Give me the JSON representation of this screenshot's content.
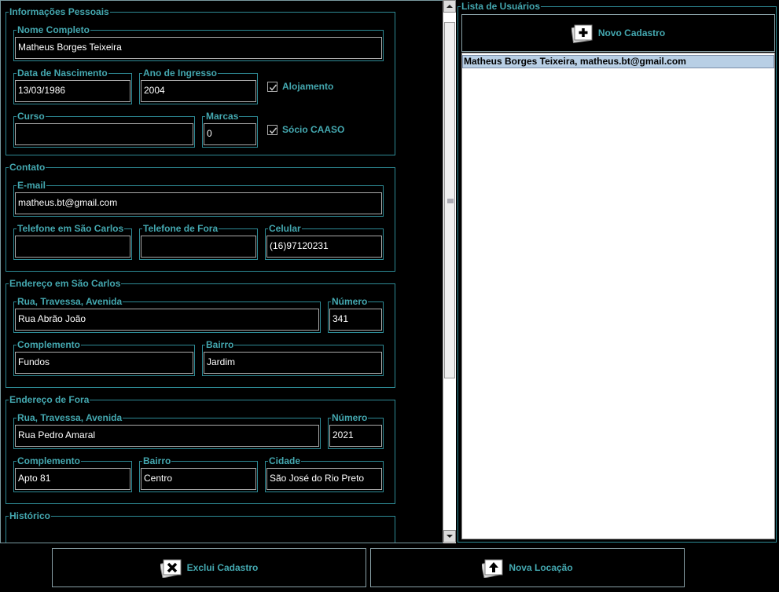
{
  "left_form": {
    "pessoais": {
      "title": "Informações Pessoais",
      "nome_label": "Nome Completo",
      "nome_value": "Matheus Borges Teixeira",
      "nascimento_label": "Data de Nascimento",
      "nascimento_value": "13/03/1986",
      "ingresso_label": "Ano de Ingresso",
      "ingresso_value": "2004",
      "alojamento_label": "Alojamento",
      "curso_label": "Curso",
      "curso_value": "",
      "marcas_label": "Marcas",
      "marcas_value": "0",
      "socio_label": "Sócio CAASO"
    },
    "contato": {
      "title": "Contato",
      "email_label": "E-mail",
      "email_value": "matheus.bt@gmail.com",
      "tel_sc_label": "Telefone em São Carlos",
      "tel_sc_value": "",
      "tel_fora_label": "Telefone de Fora",
      "tel_fora_value": "",
      "celular_label": "Celular",
      "celular_value": "(16)97120231"
    },
    "end_sc": {
      "title": "Endereço em São Carlos",
      "rua_label": "Rua, Travessa, Avenida",
      "rua_value": "Rua Abrão João",
      "numero_label": "Número",
      "numero_value": "341",
      "complemento_label": "Complemento",
      "complemento_value": "Fundos",
      "bairro_label": "Bairro",
      "bairro_value": "Jardim"
    },
    "end_fora": {
      "title": "Endereço de Fora",
      "rua_label": "Rua, Travessa, Avenida",
      "rua_value": "Rua Pedro Amaral",
      "numero_label": "Número",
      "numero_value": "2021",
      "complemento_label": "Complemento",
      "complemento_value": "Apto 81",
      "bairro_label": "Bairro",
      "bairro_value": "Centro",
      "cidade_label": "Cidade",
      "cidade_value": "São José do Rio Preto"
    },
    "historico": {
      "title": "Histórico"
    }
  },
  "right_panel": {
    "title": "Lista de Usuários",
    "novo_cadastro_label": "Novo Cadastro",
    "users": [
      "Matheus Borges Teixeira, matheus.bt@gmail.com"
    ]
  },
  "bottom": {
    "exclui_label": "Exclui Cadastro",
    "nova_locacao_label": "Nova Locação"
  },
  "checkboxes": {
    "alojamento_checked": true,
    "socio_checked": true
  },
  "colors": {
    "accent": "#44a8b0",
    "border": "#2e8b96",
    "selection": "#b8cfe5"
  }
}
